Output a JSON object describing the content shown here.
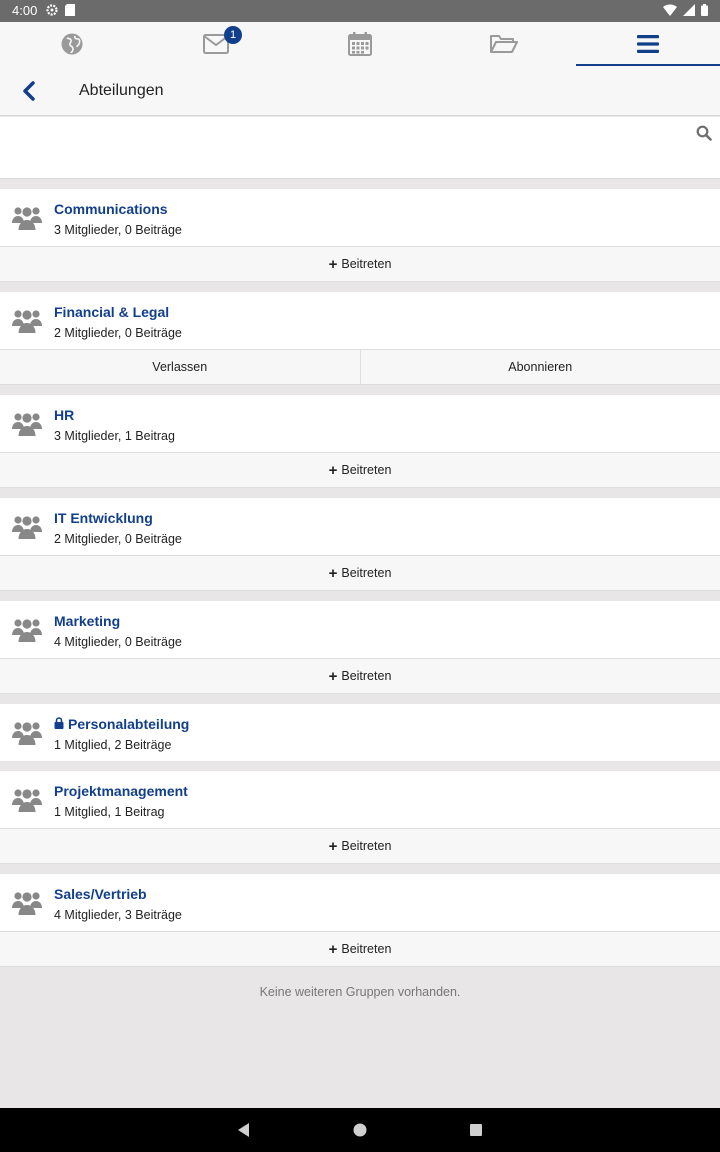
{
  "status_bar": {
    "time": "4:00"
  },
  "tabs": [
    {
      "name": "globe",
      "icon": "globe-icon"
    },
    {
      "name": "messages",
      "icon": "mail-icon",
      "badge": "1"
    },
    {
      "name": "calendar",
      "icon": "calendar-icon"
    },
    {
      "name": "files",
      "icon": "folder-icon"
    },
    {
      "name": "menu",
      "icon": "menu-icon",
      "active": true
    }
  ],
  "header": {
    "title": "Abteilungen"
  },
  "search": {
    "placeholder": ""
  },
  "colors": {
    "accent": "#123f8c",
    "background": "#e8e6e6"
  },
  "groups": [
    {
      "name": "Communications",
      "meta": "3 Mitglieder, 0 Beiträge",
      "actions": [
        "Beitreten"
      ]
    },
    {
      "name": "Financial & Legal",
      "meta": "2 Mitglieder, 0 Beiträge",
      "actions": [
        "Verlassen",
        "Abonnieren"
      ]
    },
    {
      "name": "HR",
      "meta": "3 Mitglieder, 1 Beitrag",
      "actions": [
        "Beitreten"
      ]
    },
    {
      "name": "IT Entwicklung",
      "meta": "2 Mitglieder, 0 Beiträge",
      "actions": [
        "Beitreten"
      ]
    },
    {
      "name": "Marketing",
      "meta": "4 Mitglieder, 0 Beiträge",
      "actions": [
        "Beitreten"
      ]
    },
    {
      "name": "Personalabteilung",
      "meta": "1 Mitglied, 2 Beiträge",
      "locked": true,
      "actions": []
    },
    {
      "name": "Projektmanagement",
      "meta": "1 Mitglied, 1 Beitrag",
      "actions": [
        "Beitreten"
      ]
    },
    {
      "name": "Sales/Vertrieb",
      "meta": "4 Mitglieder, 3 Beiträge",
      "actions": [
        "Beitreten"
      ]
    }
  ],
  "footer": {
    "message": "Keine weiteren Gruppen vorhanden."
  }
}
